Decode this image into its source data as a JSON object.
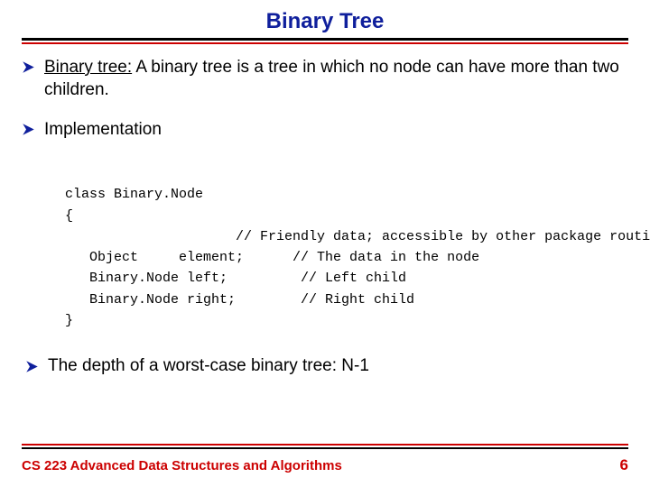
{
  "title": "Binary Tree",
  "bullets": {
    "def_term": "Binary tree:",
    "def_rest": " A binary tree is a tree in which no node can have more than two children.",
    "impl": "Implementation",
    "depth": "The depth of a worst-case binary tree: N-1"
  },
  "code": {
    "l1": "class Binary.Node",
    "l2": "{",
    "l3": "                     // Friendly data; accessible by other package routines",
    "l4": "   Object     element;      // The data in the node",
    "l5": "   Binary.Node left;         // Left child",
    "l6": "   Binary.Node right;        // Right child",
    "l7": "}"
  },
  "footer": {
    "course": "CS 223 Advanced Data Structures and Algorithms",
    "page": "6"
  }
}
